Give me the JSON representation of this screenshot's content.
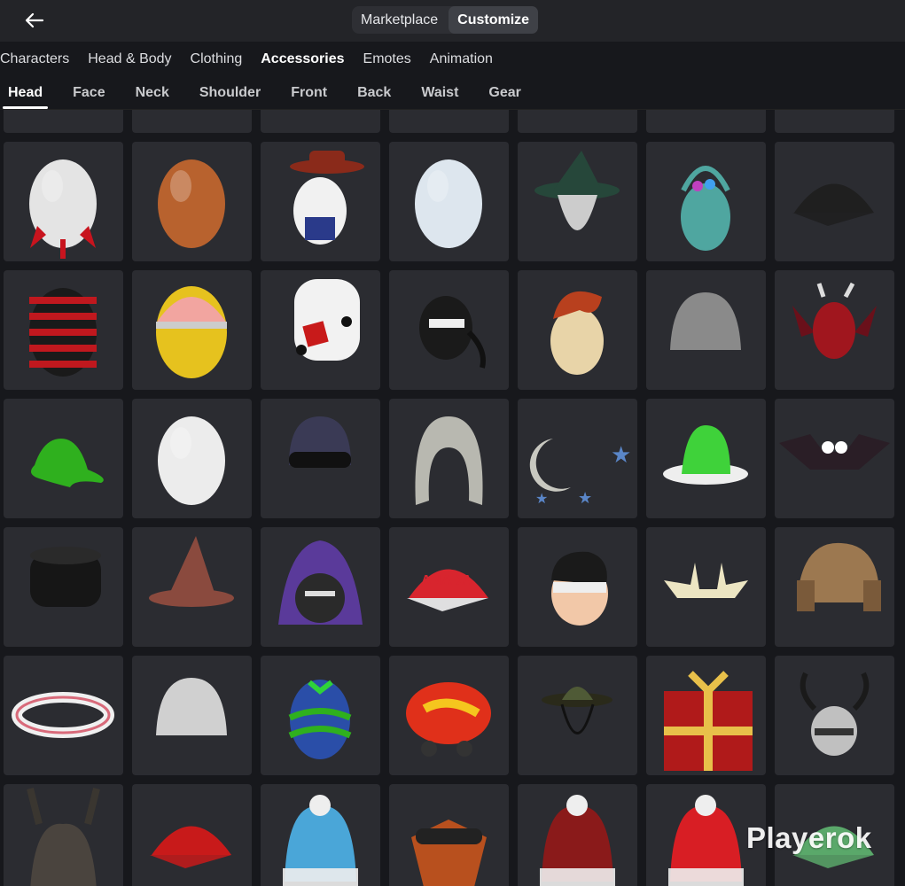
{
  "topbar": {
    "back_icon": "arrow-left-icon",
    "segments": [
      "Marketplace",
      "Customize"
    ],
    "active_segment": "Customize"
  },
  "categories": [
    "Characters",
    "Head & Body",
    "Clothing",
    "Accessories",
    "Emotes",
    "Animation"
  ],
  "active_category": "Accessories",
  "subcategories": [
    "Head",
    "Face",
    "Neck",
    "Shoulder",
    "Front",
    "Back",
    "Waist",
    "Gear"
  ],
  "active_subcategory": "Head",
  "items": [
    {
      "icon": "necklace-partial-icon",
      "color": "#a8a8a0"
    },
    {
      "icon": "purple-partial-icon",
      "color": "#5a2b8a"
    },
    {
      "icon": "empty-partial-icon",
      "color": "#2b2c31"
    },
    {
      "icon": "yellow-partial-icon",
      "color": "#7a7a20"
    },
    {
      "icon": "red-partial-icon",
      "color": "#b01515"
    },
    {
      "icon": "orange-partial-icon",
      "color": "#9a6a20"
    },
    {
      "icon": "white-green-partial-icon",
      "color": "#d9d9d9"
    },
    {
      "icon": "rocket-egg-icon",
      "color": "#e6e6e6"
    },
    {
      "icon": "brown-egg-icon",
      "color": "#b8622e"
    },
    {
      "icon": "cowboy-egg-icon",
      "color": "#f1f1f1"
    },
    {
      "icon": "white-egg-icon",
      "color": "#dde6ee"
    },
    {
      "icon": "wizard-hat-icon",
      "color": "#26473a"
    },
    {
      "icon": "easter-basket-icon",
      "color": "#4fa6a0"
    },
    {
      "icon": "black-cap-icon",
      "color": "#1f1f1f"
    },
    {
      "icon": "striped-egg-icon",
      "color": "#c0181e"
    },
    {
      "icon": "pink-yellow-egg-icon",
      "color": "#f2a5a0"
    },
    {
      "icon": "dice-head-icon",
      "color": "#f2f2f2"
    },
    {
      "icon": "ninja-mask-icon",
      "color": "#1a1a1a"
    },
    {
      "icon": "red-hair-egg-icon",
      "color": "#e8d4a8"
    },
    {
      "icon": "horned-helmet-icon",
      "color": "#8a8a8a"
    },
    {
      "icon": "dragon-egg-icon",
      "color": "#a0161e"
    },
    {
      "icon": "green-slime-icon",
      "color": "#2fb01e"
    },
    {
      "icon": "plain-egg-icon",
      "color": "#ececec"
    },
    {
      "icon": "plaid-hat-icon",
      "color": "#3a3a55"
    },
    {
      "icon": "grey-wig-icon",
      "color": "#b8b8b0"
    },
    {
      "icon": "moon-stars-icon",
      "color": "#c8c8c0"
    },
    {
      "icon": "slime-hat-icon",
      "color": "#3fd23a"
    },
    {
      "icon": "bat-eyes-icon",
      "color": "#2a1e26"
    },
    {
      "icon": "black-fur-hat-icon",
      "color": "#161616"
    },
    {
      "icon": "witch-hat-icon",
      "color": "#8a4a3e"
    },
    {
      "icon": "raven-hood-icon",
      "color": "#5a3a9a"
    },
    {
      "icon": "canada-cap-icon",
      "color": "#d8252e"
    },
    {
      "icon": "robin-mask-icon",
      "color": "#1a1a1a"
    },
    {
      "icon": "antlers-icon",
      "color": "#ece5c2"
    },
    {
      "icon": "trapper-hat-icon",
      "color": "#9c7850"
    },
    {
      "icon": "headband-icon",
      "color": "#f0f0f0"
    },
    {
      "icon": "newspaper-hat-icon",
      "color": "#d0d0d0"
    },
    {
      "icon": "painted-egg-icon",
      "color": "#2a4ea8"
    },
    {
      "icon": "flame-helmet-icon",
      "color": "#e0301a"
    },
    {
      "icon": "safari-hat-icon",
      "color": "#4f5a36"
    },
    {
      "icon": "plaid-gift-icon",
      "color": "#b01a1a"
    },
    {
      "icon": "knight-antlers-icon",
      "color": "#c0c0c0"
    },
    {
      "icon": "dark-helmet-icon",
      "color": "#4a443e"
    },
    {
      "icon": "red-cap-icon",
      "color": "#c81a1a"
    },
    {
      "icon": "snowman-beanie-icon",
      "color": "#4aa6d8"
    },
    {
      "icon": "fox-goggles-icon",
      "color": "#b8501e"
    },
    {
      "icon": "roblox-beanie-icon",
      "color": "#8a1a1a"
    },
    {
      "icon": "canada-beanie-icon",
      "color": "#d81e24"
    },
    {
      "icon": "green-plaid-cap-icon",
      "color": "#5aa86a"
    }
  ],
  "watermark": "Playerok"
}
